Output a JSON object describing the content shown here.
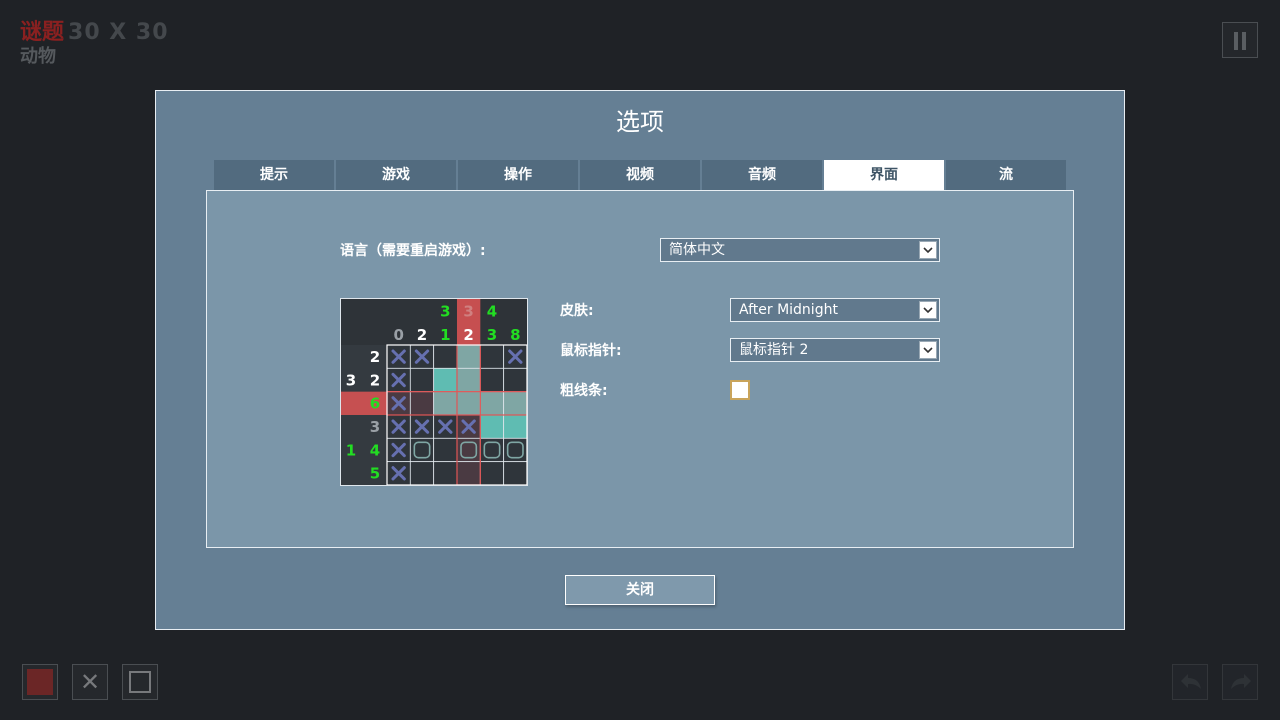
{
  "header": {
    "puzzle_label": "谜题",
    "size_label": "30 X 30",
    "category": "动物"
  },
  "icons": {
    "pause": "pause-icon",
    "fill_tool": "fill-square-icon",
    "cross_tool": "cross-icon",
    "box_tool": "empty-square-icon",
    "undo": "undo-arrow-icon",
    "redo": "redo-arrow-icon",
    "dropdown": "chevron-down-icon"
  },
  "tools": {
    "cross_glyph": "✕"
  },
  "dialog": {
    "title": "选项",
    "tabs": [
      {
        "label": "提示",
        "active": false
      },
      {
        "label": "游戏",
        "active": false
      },
      {
        "label": "操作",
        "active": false
      },
      {
        "label": "视频",
        "active": false
      },
      {
        "label": "音频",
        "active": false
      },
      {
        "label": "界面",
        "active": true
      },
      {
        "label": "流",
        "active": false
      }
    ],
    "language": {
      "label": "语言（需要重启游戏）:",
      "value": "简体中文"
    },
    "skin": {
      "label": "皮肤:",
      "value": "After Midnight"
    },
    "cursor": {
      "label": "鼠标指针:",
      "value": "鼠标指针 2"
    },
    "thick_lines": {
      "label": "粗线条:",
      "checked": false
    },
    "close_label": "关闭"
  },
  "preview": {
    "column_clues": [
      [
        "0"
      ],
      [
        "2"
      ],
      [
        "3",
        "1"
      ],
      [
        "3",
        "2"
      ],
      [
        "4",
        "3"
      ],
      [
        "8"
      ]
    ],
    "row_clues": [
      [
        "2"
      ],
      [
        "3",
        "2"
      ],
      [
        "6"
      ],
      [
        "3"
      ],
      [
        "1",
        "4"
      ],
      [
        "5"
      ]
    ],
    "grid": [
      [
        "x",
        "x",
        "",
        "g",
        "",
        "x"
      ],
      [
        "x",
        "",
        "t",
        "g",
        "",
        ""
      ],
      [
        "x",
        "",
        "g",
        "g",
        "g",
        "g"
      ],
      [
        "x",
        "x",
        "x",
        "x",
        "t",
        "t"
      ],
      [
        "x",
        "o",
        "",
        "o",
        "o",
        "o"
      ],
      [
        "x",
        "",
        "",
        "",
        "",
        ""
      ]
    ],
    "highlight_row": 2,
    "highlight_col": 3,
    "colors": {
      "clue_white": "#ffffff",
      "clue_green": "#22dd22",
      "clue_dim": "#9aa0a6",
      "highlight": "#e05555",
      "filled": "#5fbcb2",
      "cross": "#6670b0"
    }
  }
}
